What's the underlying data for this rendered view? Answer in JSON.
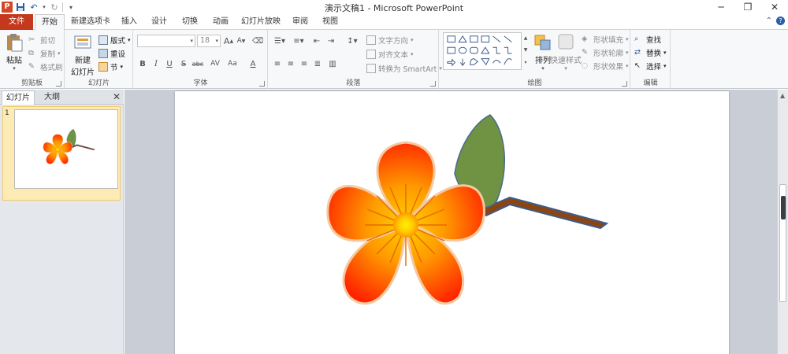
{
  "window": {
    "title": "演示文稿1 - Microsoft PowerPoint",
    "app_icon_letter": "P"
  },
  "tabs": [
    {
      "label": "文件"
    },
    {
      "label": "开始"
    },
    {
      "label": "新建选项卡"
    },
    {
      "label": "插入"
    },
    {
      "label": "设计"
    },
    {
      "label": "切换"
    },
    {
      "label": "动画"
    },
    {
      "label": "幻灯片放映"
    },
    {
      "label": "审阅"
    },
    {
      "label": "视图"
    }
  ],
  "ribbon": {
    "clipboard": {
      "label": "剪贴板",
      "paste": "粘贴",
      "cut": "剪切",
      "copy": "复制",
      "format_painter": "格式刷"
    },
    "slides": {
      "label": "幻灯片",
      "new_slide_line1": "新建",
      "new_slide_line2": "幻灯片",
      "layout": "版式",
      "reset": "重设",
      "section": "节"
    },
    "font": {
      "label": "字体",
      "font_name": "",
      "font_size": "18",
      "grow": "A",
      "shrink": "A",
      "bold": "B",
      "italic": "I",
      "underline": "U",
      "strike": "S",
      "shadow": "abc",
      "spacing": "AV",
      "case": "Aa",
      "color": "A"
    },
    "paragraph": {
      "label": "段落",
      "text_direction": "文字方向",
      "align_text": "对齐文本",
      "convert_smartart": "转换为 SmartArt"
    },
    "drawing": {
      "label": "绘图",
      "arrange": "排列",
      "quick_styles": "快速样式",
      "shape_fill": "形状填充",
      "shape_outline": "形状轮廓",
      "shape_effects": "形状效果"
    },
    "editing": {
      "label": "编辑",
      "find": "查找",
      "replace": "替换",
      "select": "选择"
    }
  },
  "left_pane": {
    "tab_slides": "幻灯片",
    "tab_outline": "大纲",
    "slide_number": "1"
  },
  "colors": {
    "file_tab": "#c4391d",
    "leaf": "#6f9343",
    "stem": "#8b4513",
    "petal_outer": "#ff2a00",
    "petal_inner": "#ffb000",
    "center": "#ffe400"
  }
}
